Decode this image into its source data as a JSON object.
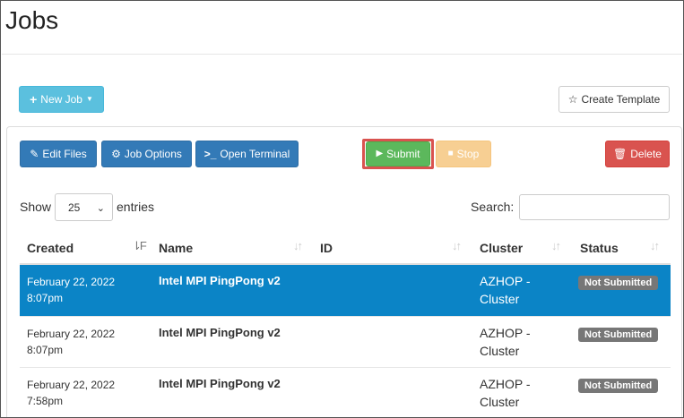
{
  "page": {
    "title": "Jobs"
  },
  "toolbar": {
    "new_job": "New Job",
    "create_template": "Create Template",
    "edit_files": "Edit Files",
    "job_options": "Job Options",
    "open_terminal": "Open Terminal",
    "submit": "Submit",
    "stop": "Stop",
    "delete": "Delete"
  },
  "table_controls": {
    "show_label": "Show",
    "page_size": "25",
    "entries_label": "entries",
    "search_label": "Search:"
  },
  "table": {
    "columns": [
      "Created",
      "Name",
      "ID",
      "Cluster",
      "Status"
    ],
    "rows": [
      {
        "date": "February 22, 2022",
        "time": "8:07pm",
        "name": "Intel MPI PingPong v2",
        "id": "",
        "cluster1": "AZHOP -",
        "cluster2": "Cluster",
        "status": "Not Submitted"
      },
      {
        "date": "February 22, 2022",
        "time": "8:07pm",
        "name": "Intel MPI PingPong v2",
        "id": "",
        "cluster1": "AZHOP -",
        "cluster2": "Cluster",
        "status": "Not Submitted"
      },
      {
        "date": "February 22, 2022",
        "time": "7:58pm",
        "name": "Intel MPI PingPong v2",
        "id": "",
        "cluster1": "AZHOP -",
        "cluster2": "Cluster",
        "status": "Not Submitted"
      }
    ]
  },
  "colors": {
    "selected_row": "#0b84c6",
    "highlight": "#d9534f"
  }
}
